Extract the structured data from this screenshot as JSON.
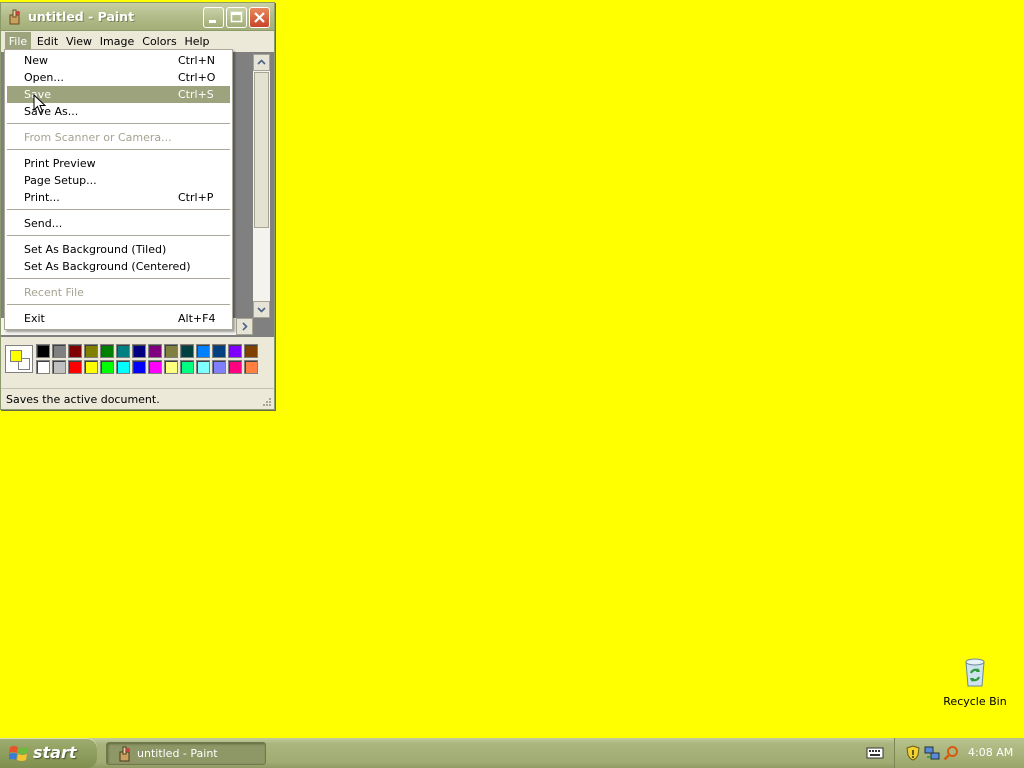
{
  "window": {
    "title": "untitled - Paint"
  },
  "menubar": {
    "items": [
      "File",
      "Edit",
      "View",
      "Image",
      "Colors",
      "Help"
    ],
    "active": "File"
  },
  "file_menu": {
    "items": [
      {
        "label": "New",
        "shortcut": "Ctrl+N",
        "enabled": true
      },
      {
        "label": "Open...",
        "shortcut": "Ctrl+O",
        "enabled": true
      },
      {
        "label": "Save",
        "shortcut": "Ctrl+S",
        "enabled": true,
        "highlighted": true
      },
      {
        "label": "Save As...",
        "shortcut": "",
        "enabled": true
      },
      {
        "label": "From Scanner or Camera...",
        "shortcut": "",
        "enabled": false
      },
      {
        "label": "Print Preview",
        "shortcut": "",
        "enabled": true
      },
      {
        "label": "Page Setup...",
        "shortcut": "",
        "enabled": true
      },
      {
        "label": "Print...",
        "shortcut": "Ctrl+P",
        "enabled": true
      },
      {
        "label": "Send...",
        "shortcut": "",
        "enabled": true
      },
      {
        "label": "Set As Background (Tiled)",
        "shortcut": "",
        "enabled": true
      },
      {
        "label": "Set As Background (Centered)",
        "shortcut": "",
        "enabled": true
      },
      {
        "label": "Recent File",
        "shortcut": "",
        "enabled": false
      },
      {
        "label": "Exit",
        "shortcut": "Alt+F4",
        "enabled": true
      }
    ]
  },
  "palette": {
    "foreground": "#ffff00",
    "background": "#ffffff",
    "top_row": [
      "#000000",
      "#808080",
      "#800000",
      "#808000",
      "#008000",
      "#008080",
      "#000080",
      "#800080",
      "#808040",
      "#004040",
      "#0080ff",
      "#004080",
      "#8000ff",
      "#804000"
    ],
    "bottom_row": [
      "#ffffff",
      "#c0c0c0",
      "#ff0000",
      "#ffff00",
      "#00ff00",
      "#00ffff",
      "#0000ff",
      "#ff00ff",
      "#ffff80",
      "#00ff80",
      "#80ffff",
      "#8080ff",
      "#ff0080",
      "#ff8040"
    ]
  },
  "status": {
    "text": "Saves the active document."
  },
  "desktop": {
    "background_color": "#ffff00",
    "recycle_bin_label": "Recycle Bin"
  },
  "taskbar": {
    "start_label": "start",
    "task_label": "untitled - Paint",
    "clock": "4:08 AM"
  }
}
